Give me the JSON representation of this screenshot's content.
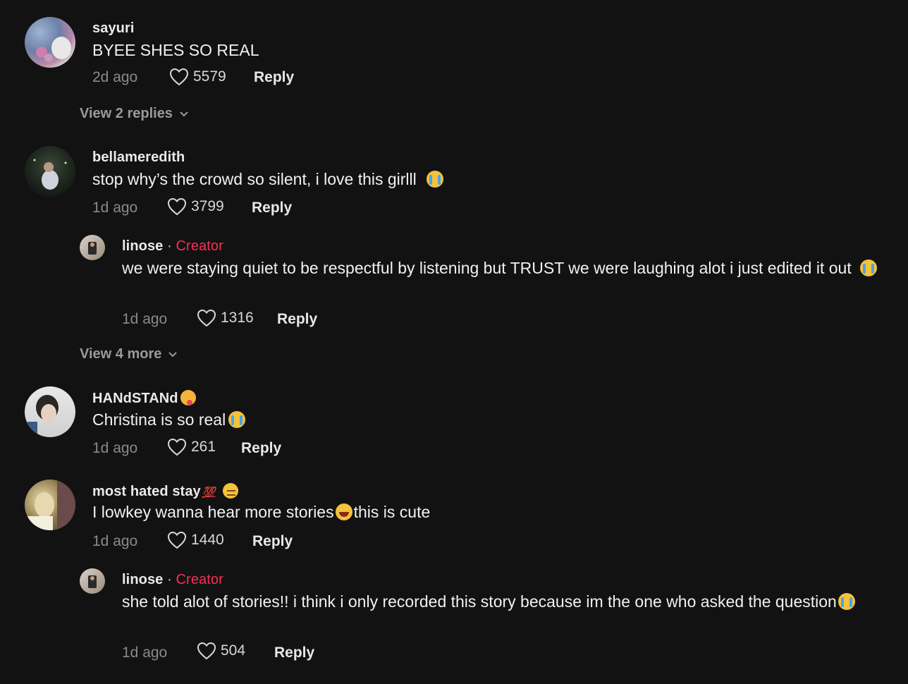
{
  "comments": [
    {
      "user": "sayuri",
      "text": "BYEE SHES SO REAL",
      "time": "2d ago",
      "likes": "5579",
      "reply": "Reply",
      "view": "View 2 replies"
    },
    {
      "user": "bellameredith",
      "text": "stop why’s the crowd so silent, i love this girlll",
      "time": "1d ago",
      "likes": "3799",
      "reply": "Reply",
      "creator_reply": {
        "user": "linose",
        "sep": "·",
        "badge": "Creator",
        "text": "we were staying quiet to be respectful by listening but TRUST we were laughing alot i just edited it out",
        "time": "1d ago",
        "likes": "1316",
        "reply": "Reply"
      },
      "view": "View 4 more"
    },
    {
      "user": "HANdSTANd",
      "text": "Christina is so real",
      "time": "1d ago",
      "likes": "261",
      "reply": "Reply"
    },
    {
      "user": "most hated stay",
      "user_suffix": "💯",
      "text_a": "I lowkey wanna hear more stories",
      "text_b": "this is cute",
      "time": "1d ago",
      "likes": "1440",
      "reply": "Reply",
      "creator_reply": {
        "user": "linose",
        "sep": "·",
        "badge": "Creator",
        "text": "she told alot of stories!! i think i only recorded this story because im the one who asked the question",
        "time": "1d ago",
        "likes": "504",
        "reply": "Reply"
      }
    }
  ],
  "icons": {
    "like": "heart-outline-icon",
    "expand": "chevron-down-icon"
  },
  "colors": {
    "background": "#121212",
    "creator_badge": "#fe2c55",
    "muted": "#8a8a8a"
  }
}
